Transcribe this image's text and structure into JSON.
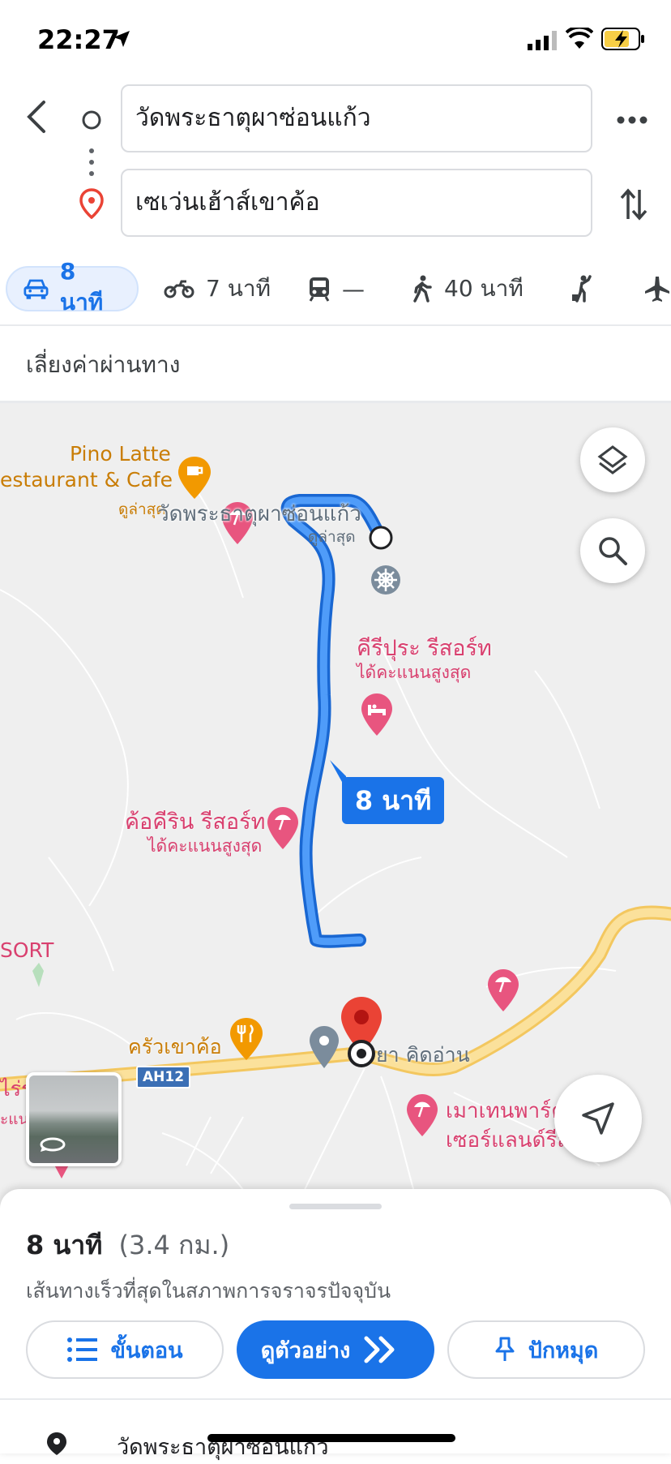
{
  "status_bar": {
    "time": "22:27"
  },
  "search": {
    "origin": "วัดพระธาตุผาซ่อนแก้ว",
    "destination": "เซเว่นเฮ้าส์เขาค้อ"
  },
  "modes": [
    {
      "icon": "car-icon",
      "label": "8 นาที"
    },
    {
      "icon": "motorcycle-icon",
      "label": "7 นาที"
    },
    {
      "icon": "transit-icon",
      "label": "—"
    },
    {
      "icon": "walk-icon",
      "label": "40 นาที"
    },
    {
      "icon": "ride-hail-icon",
      "label": ""
    },
    {
      "icon": "flight-icon",
      "label": ""
    }
  ],
  "options": {
    "avoid_tolls": "เลี่ยงค่าผ่านทาง"
  },
  "map": {
    "places": {
      "pino_line1": "Pino Latte",
      "pino_line2": "estaurant & Cafe",
      "pino_sub": "ดูล่าสุด",
      "temple": "วัดพระธาตุผาซ่อนแก้ว",
      "temple_sub": "ดูล่าสุด",
      "khiri": "คีรีปุระ รีสอร์ท",
      "khiri_sub": "ได้คะแนนสูงสุด",
      "kho": "ค้อคีริน รีสอร์ท",
      "kho_sub": "ได้คะแนนสูงสุด",
      "sort": "SORT",
      "krua": "ครัวเขาค้อ",
      "pharmacy": "ยา คิดอ่าน",
      "mountain_1": "เมาเทนพาร์ค",
      "mountain_2": "เซอร์แลนด์รีส",
      "left_1": "ไร่ร",
      "left_2": "ะแน"
    },
    "highway": "AH12",
    "route_duration": "8 นาที"
  },
  "sheet": {
    "duration": "8 นาที",
    "distance": "(3.4 กม.)",
    "note": "เส้นทางเร็วที่สุดในสภาพการจราจรปัจจุบัน",
    "steps_label": "ขั้นตอน",
    "preview_label": "ดูตัวอย่าง",
    "pin_label": "ปักหมุด",
    "first_step": "วัดพระธาตุผาซ่อนแก้ว"
  },
  "colors": {
    "route": "#1a73e8",
    "accent": "#1a73e8",
    "destination_pin": "#ea4335",
    "poi_pink": "#e8557f",
    "poi_orange": "#f29900",
    "road_yellow": "#fbd784"
  }
}
